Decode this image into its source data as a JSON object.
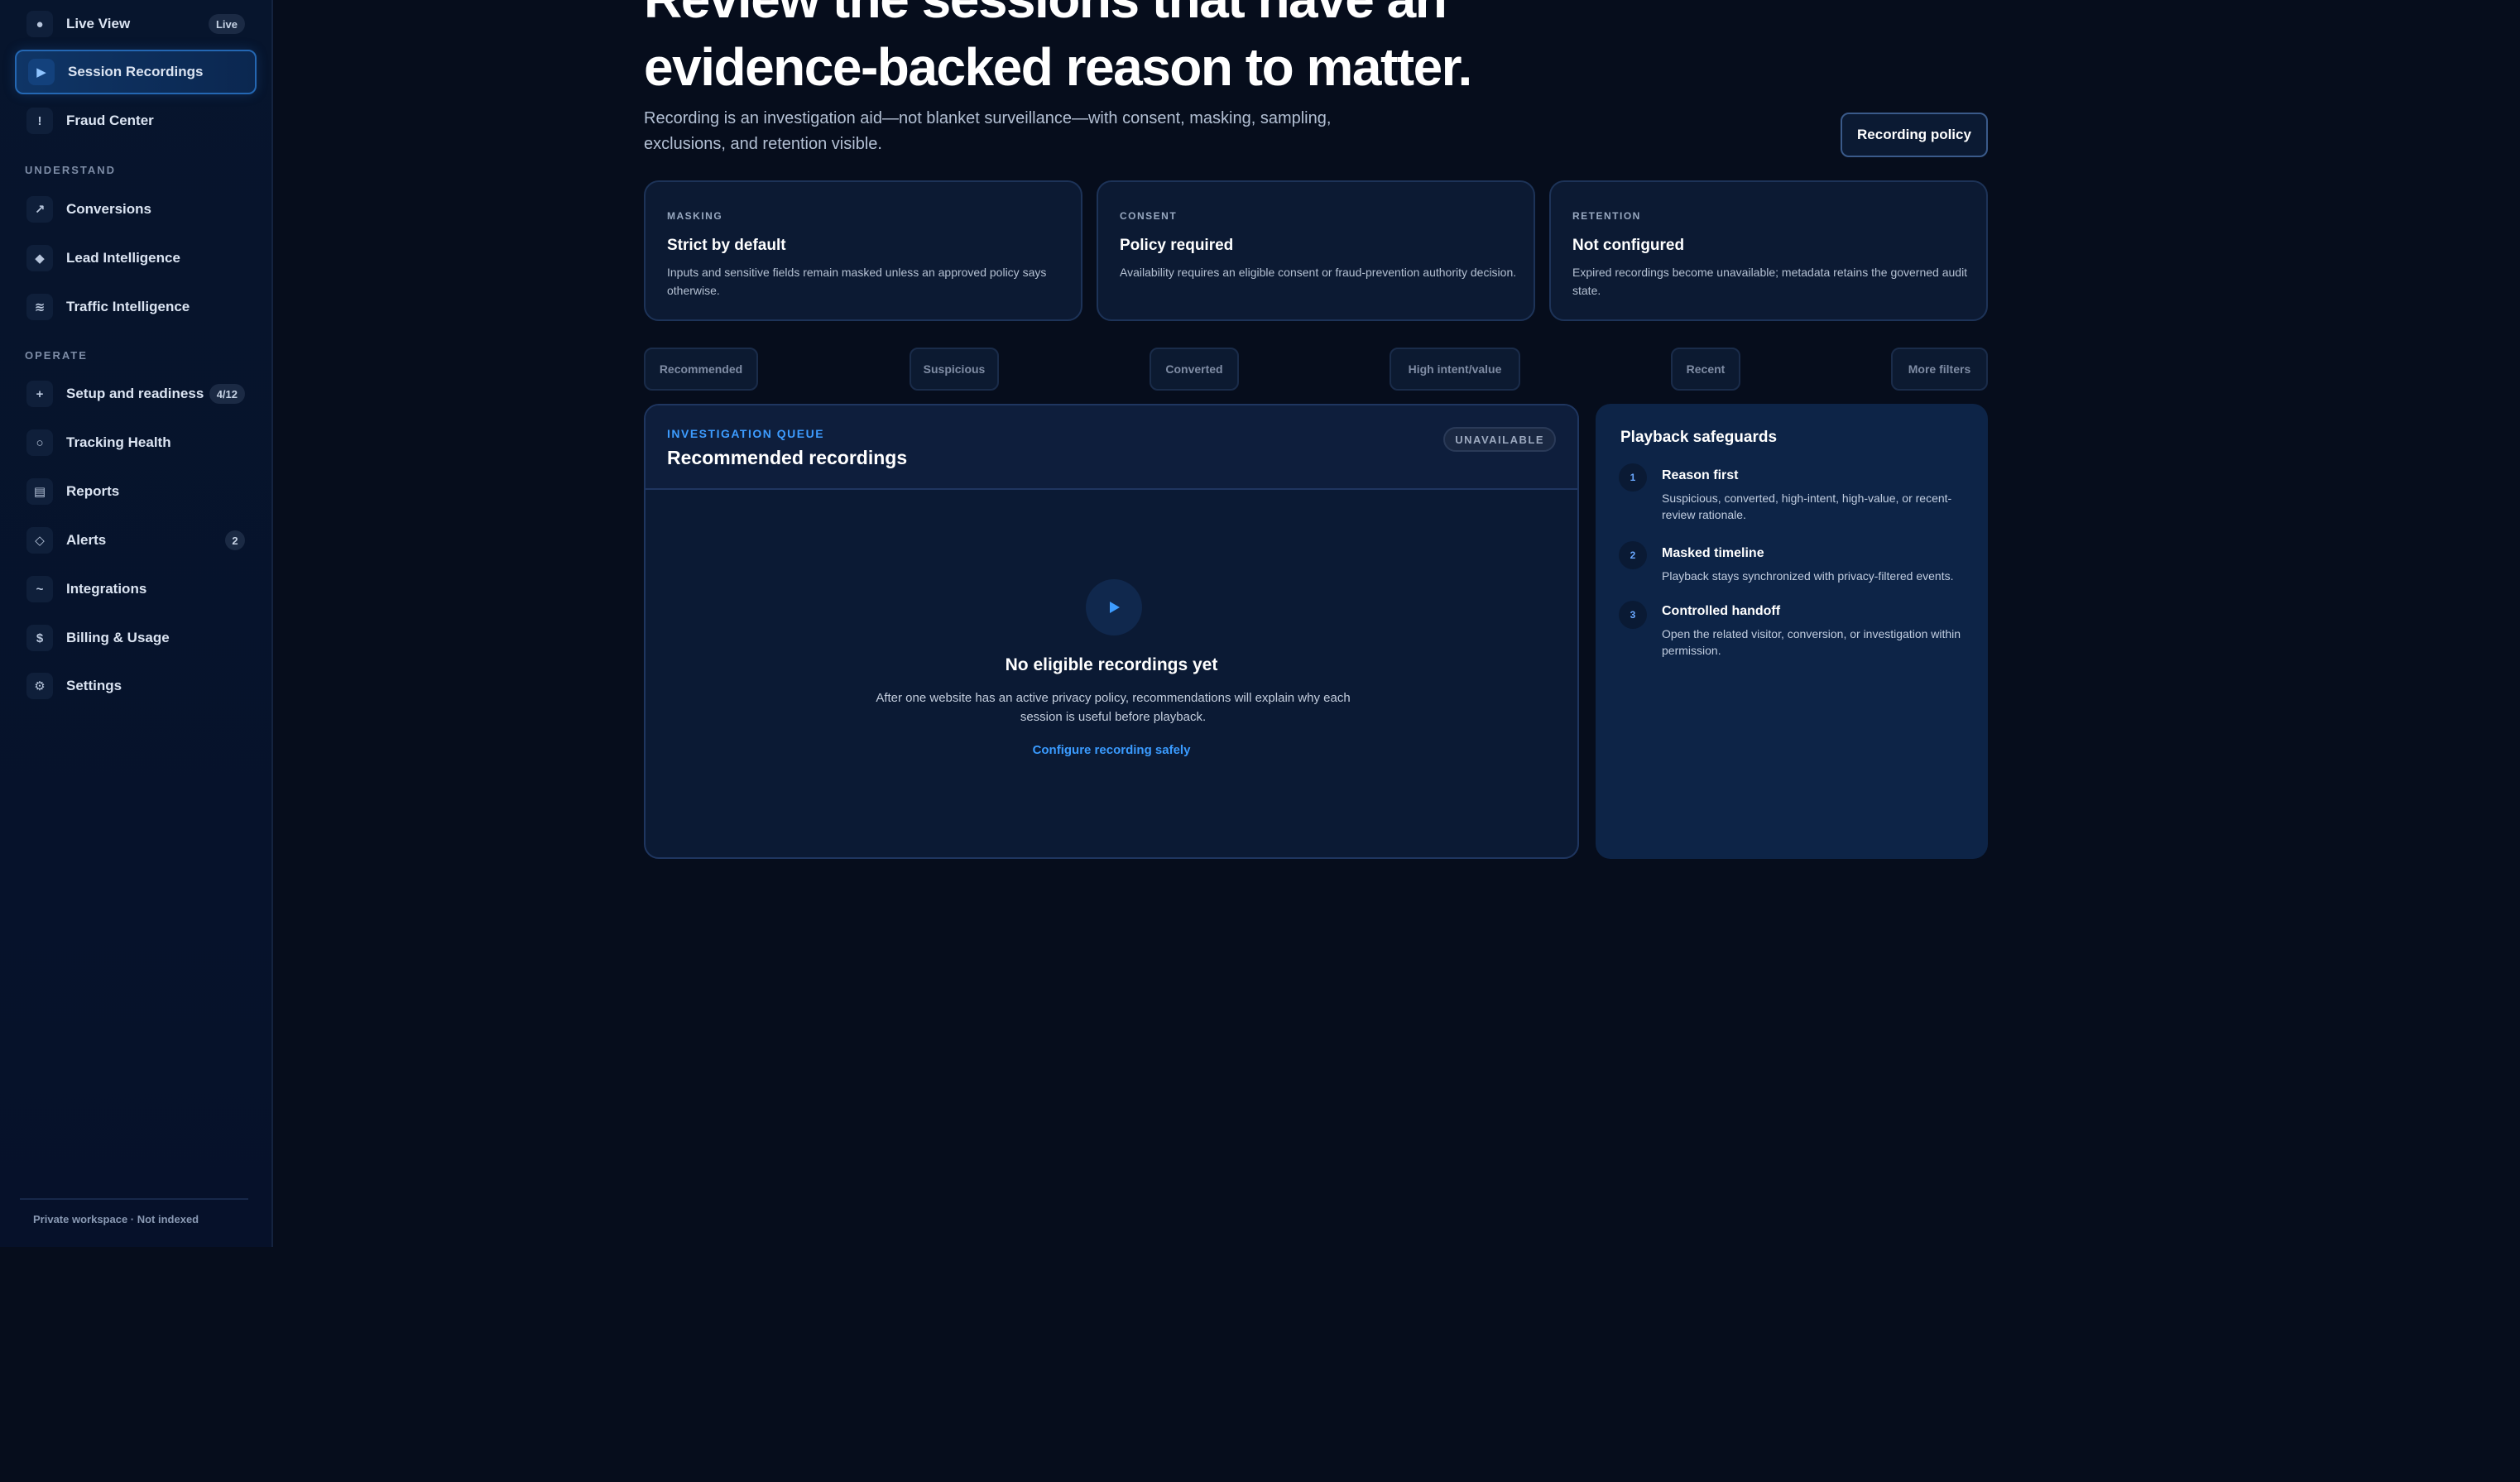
{
  "sidebar": {
    "items_top": [
      {
        "label": "Live View",
        "icon": "dot-icon",
        "glyph": "●",
        "badge": "Live"
      },
      {
        "label": "Session Recordings",
        "icon": "play-icon",
        "glyph": "▶",
        "active": true
      },
      {
        "label": "Fraud Center",
        "icon": "alert-icon",
        "glyph": "!"
      }
    ],
    "section_understand": "UNDERSTAND",
    "items_understand": [
      {
        "label": "Conversions",
        "icon": "trend-arrow-icon",
        "glyph": "↗"
      },
      {
        "label": "Lead Intelligence",
        "icon": "diamond-icon",
        "glyph": "◆"
      },
      {
        "label": "Traffic Intelligence",
        "icon": "waves-icon",
        "glyph": "≋"
      }
    ],
    "section_operate": "OPERATE",
    "items_operate": [
      {
        "label": "Setup and readiness",
        "icon": "plus-icon",
        "glyph": "+",
        "badge": "4/12"
      },
      {
        "label": "Tracking Health",
        "icon": "circle-icon",
        "glyph": "○"
      },
      {
        "label": "Reports",
        "icon": "report-icon",
        "glyph": "▤"
      },
      {
        "label": "Alerts",
        "icon": "diamond-outline-icon",
        "glyph": "◇",
        "badge": "2"
      },
      {
        "label": "Integrations",
        "icon": "link-icon",
        "glyph": "~"
      },
      {
        "label": "Billing & Usage",
        "icon": "dollar-icon",
        "glyph": "$"
      },
      {
        "label": "Settings",
        "icon": "gear-icon",
        "glyph": "⚙"
      }
    ],
    "footer": "Private workspace · Not indexed"
  },
  "header": {
    "title": "Review the sessions that have an evidence-backed reason to matter.",
    "subtitle": "Recording is an investigation aid—not blanket surveillance—with consent, masking, sampling, exclusions, and retention visible.",
    "policy_button": "Recording policy"
  },
  "cards": [
    {
      "kicker": "MASKING",
      "title": "Strict by default",
      "text": "Inputs and sensitive fields remain masked unless an approved policy says otherwise."
    },
    {
      "kicker": "CONSENT",
      "title": "Policy required",
      "text": "Availability requires an eligible consent or fraud-prevention authority decision."
    },
    {
      "kicker": "RETENTION",
      "title": "Not configured",
      "text": "Expired recordings become unavailable; metadata retains the governed audit state."
    }
  ],
  "filters": [
    "Recommended",
    "Suspicious",
    "Converted",
    "High intent/value",
    "Recent",
    "More filters"
  ],
  "queue": {
    "kicker": "INVESTIGATION QUEUE",
    "title": "Recommended recordings",
    "status": "UNAVAILABLE",
    "empty_title": "No eligible recordings yet",
    "empty_text": "After one website has an active privacy policy, recommendations will explain why each session is useful before playback.",
    "empty_link": "Configure recording safely"
  },
  "safeguards": {
    "title": "Playback safeguards",
    "steps": [
      {
        "num": "1",
        "title": "Reason first",
        "text": "Suspicious, converted, high-intent, high-value, or recent-review rationale."
      },
      {
        "num": "2",
        "title": "Masked timeline",
        "text": "Playback stays synchronized with privacy-filtered events."
      },
      {
        "num": "3",
        "title": "Controlled handoff",
        "text": "Open the related visitor, conversion, or investigation within permission."
      }
    ]
  },
  "colors": {
    "accent": "#3d9cff",
    "background": "#060d1c",
    "panel": "#0b1a34"
  }
}
